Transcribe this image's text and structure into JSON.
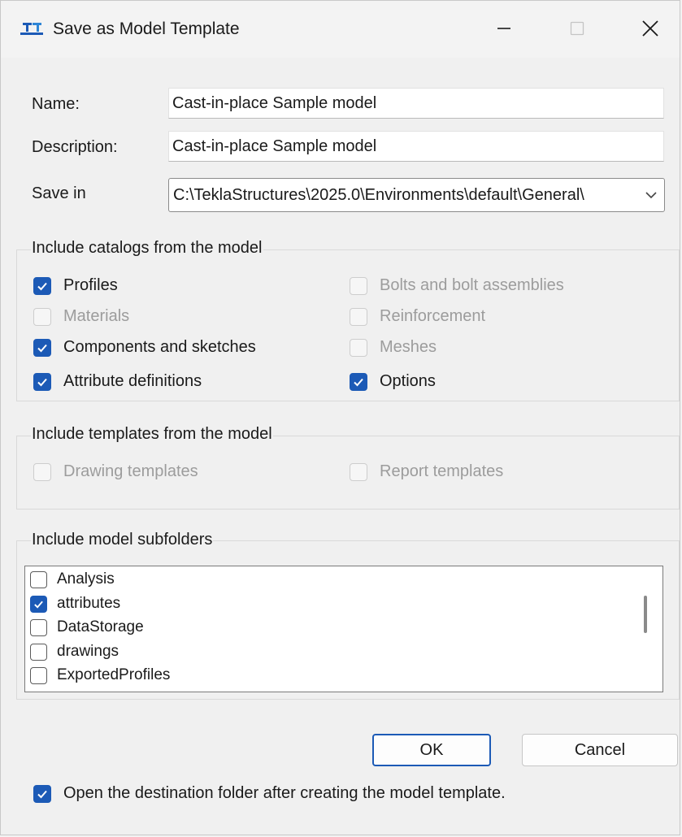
{
  "window": {
    "title": "Save as Model Template",
    "icon": "tekla-app-icon",
    "controls": [
      "minimize-icon",
      "maximize-icon",
      "close-icon"
    ]
  },
  "form": {
    "name_label": "Name:",
    "name_value": "Cast-in-place Sample model",
    "description_label": "Description:",
    "description_value": "Cast-in-place Sample model",
    "save_in_label": "Save in",
    "save_in_value": "C:\\TeklaStructures\\2025.0\\Environments\\default\\General\\"
  },
  "catalogs": {
    "title": "Include catalogs from the model",
    "items": [
      {
        "label": "Profiles",
        "checked": true,
        "enabled": true
      },
      {
        "label": "Materials",
        "checked": false,
        "enabled": false
      },
      {
        "label": "Components and sketches",
        "checked": true,
        "enabled": true
      },
      {
        "label": "Attribute definitions",
        "checked": true,
        "enabled": true
      },
      {
        "label": "Bolts and bolt assemblies",
        "checked": false,
        "enabled": false
      },
      {
        "label": "Reinforcement",
        "checked": false,
        "enabled": false
      },
      {
        "label": "Meshes",
        "checked": false,
        "enabled": false
      },
      {
        "label": "Options",
        "checked": true,
        "enabled": true
      }
    ]
  },
  "templates": {
    "title": "Include templates from the model",
    "items": [
      {
        "label": "Drawing templates",
        "checked": false,
        "enabled": false
      },
      {
        "label": "Report templates",
        "checked": false,
        "enabled": false
      }
    ]
  },
  "subfolders": {
    "title": "Include model subfolders",
    "items": [
      {
        "label": "Analysis",
        "checked": false
      },
      {
        "label": "attributes",
        "checked": true
      },
      {
        "label": "DataStorage",
        "checked": false
      },
      {
        "label": "drawings",
        "checked": false
      },
      {
        "label": "ExportedProfiles",
        "checked": false
      }
    ]
  },
  "buttons": {
    "ok": "OK",
    "cancel": "Cancel"
  },
  "footer": {
    "open_folder_label": "Open the destination folder after creating the model template.",
    "open_folder_checked": true
  },
  "colors": {
    "accent": "#1c5ab6",
    "disabled_text": "#9c9c9c"
  }
}
